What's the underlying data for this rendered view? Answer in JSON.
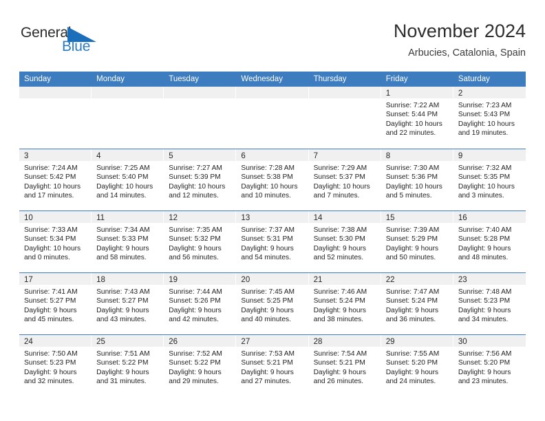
{
  "logo": {
    "word_one": "General",
    "word_two": "Blue",
    "triangle_icon": "blue-triangle-icon",
    "blue": "#2b7cc4",
    "dark": "#2b2b2b"
  },
  "header": {
    "title": "November 2024",
    "subtitle": "Arbucies, Catalonia, Spain"
  },
  "calendar": {
    "accent_color": "#3c7cbf",
    "day_band_color": "#f0f0f0",
    "weekdays": [
      "Sunday",
      "Monday",
      "Tuesday",
      "Wednesday",
      "Thursday",
      "Friday",
      "Saturday"
    ],
    "weeks": [
      [
        {
          "day": "",
          "lines": []
        },
        {
          "day": "",
          "lines": []
        },
        {
          "day": "",
          "lines": []
        },
        {
          "day": "",
          "lines": []
        },
        {
          "day": "",
          "lines": []
        },
        {
          "day": "1",
          "lines": [
            "Sunrise: 7:22 AM",
            "Sunset: 5:44 PM",
            "Daylight: 10 hours",
            "and 22 minutes."
          ]
        },
        {
          "day": "2",
          "lines": [
            "Sunrise: 7:23 AM",
            "Sunset: 5:43 PM",
            "Daylight: 10 hours",
            "and 19 minutes."
          ]
        }
      ],
      [
        {
          "day": "3",
          "lines": [
            "Sunrise: 7:24 AM",
            "Sunset: 5:42 PM",
            "Daylight: 10 hours",
            "and 17 minutes."
          ]
        },
        {
          "day": "4",
          "lines": [
            "Sunrise: 7:25 AM",
            "Sunset: 5:40 PM",
            "Daylight: 10 hours",
            "and 14 minutes."
          ]
        },
        {
          "day": "5",
          "lines": [
            "Sunrise: 7:27 AM",
            "Sunset: 5:39 PM",
            "Daylight: 10 hours",
            "and 12 minutes."
          ]
        },
        {
          "day": "6",
          "lines": [
            "Sunrise: 7:28 AM",
            "Sunset: 5:38 PM",
            "Daylight: 10 hours",
            "and 10 minutes."
          ]
        },
        {
          "day": "7",
          "lines": [
            "Sunrise: 7:29 AM",
            "Sunset: 5:37 PM",
            "Daylight: 10 hours",
            "and 7 minutes."
          ]
        },
        {
          "day": "8",
          "lines": [
            "Sunrise: 7:30 AM",
            "Sunset: 5:36 PM",
            "Daylight: 10 hours",
            "and 5 minutes."
          ]
        },
        {
          "day": "9",
          "lines": [
            "Sunrise: 7:32 AM",
            "Sunset: 5:35 PM",
            "Daylight: 10 hours",
            "and 3 minutes."
          ]
        }
      ],
      [
        {
          "day": "10",
          "lines": [
            "Sunrise: 7:33 AM",
            "Sunset: 5:34 PM",
            "Daylight: 10 hours",
            "and 0 minutes."
          ]
        },
        {
          "day": "11",
          "lines": [
            "Sunrise: 7:34 AM",
            "Sunset: 5:33 PM",
            "Daylight: 9 hours",
            "and 58 minutes."
          ]
        },
        {
          "day": "12",
          "lines": [
            "Sunrise: 7:35 AM",
            "Sunset: 5:32 PM",
            "Daylight: 9 hours",
            "and 56 minutes."
          ]
        },
        {
          "day": "13",
          "lines": [
            "Sunrise: 7:37 AM",
            "Sunset: 5:31 PM",
            "Daylight: 9 hours",
            "and 54 minutes."
          ]
        },
        {
          "day": "14",
          "lines": [
            "Sunrise: 7:38 AM",
            "Sunset: 5:30 PM",
            "Daylight: 9 hours",
            "and 52 minutes."
          ]
        },
        {
          "day": "15",
          "lines": [
            "Sunrise: 7:39 AM",
            "Sunset: 5:29 PM",
            "Daylight: 9 hours",
            "and 50 minutes."
          ]
        },
        {
          "day": "16",
          "lines": [
            "Sunrise: 7:40 AM",
            "Sunset: 5:28 PM",
            "Daylight: 9 hours",
            "and 48 minutes."
          ]
        }
      ],
      [
        {
          "day": "17",
          "lines": [
            "Sunrise: 7:41 AM",
            "Sunset: 5:27 PM",
            "Daylight: 9 hours",
            "and 45 minutes."
          ]
        },
        {
          "day": "18",
          "lines": [
            "Sunrise: 7:43 AM",
            "Sunset: 5:27 PM",
            "Daylight: 9 hours",
            "and 43 minutes."
          ]
        },
        {
          "day": "19",
          "lines": [
            "Sunrise: 7:44 AM",
            "Sunset: 5:26 PM",
            "Daylight: 9 hours",
            "and 42 minutes."
          ]
        },
        {
          "day": "20",
          "lines": [
            "Sunrise: 7:45 AM",
            "Sunset: 5:25 PM",
            "Daylight: 9 hours",
            "and 40 minutes."
          ]
        },
        {
          "day": "21",
          "lines": [
            "Sunrise: 7:46 AM",
            "Sunset: 5:24 PM",
            "Daylight: 9 hours",
            "and 38 minutes."
          ]
        },
        {
          "day": "22",
          "lines": [
            "Sunrise: 7:47 AM",
            "Sunset: 5:24 PM",
            "Daylight: 9 hours",
            "and 36 minutes."
          ]
        },
        {
          "day": "23",
          "lines": [
            "Sunrise: 7:48 AM",
            "Sunset: 5:23 PM",
            "Daylight: 9 hours",
            "and 34 minutes."
          ]
        }
      ],
      [
        {
          "day": "24",
          "lines": [
            "Sunrise: 7:50 AM",
            "Sunset: 5:23 PM",
            "Daylight: 9 hours",
            "and 32 minutes."
          ]
        },
        {
          "day": "25",
          "lines": [
            "Sunrise: 7:51 AM",
            "Sunset: 5:22 PM",
            "Daylight: 9 hours",
            "and 31 minutes."
          ]
        },
        {
          "day": "26",
          "lines": [
            "Sunrise: 7:52 AM",
            "Sunset: 5:22 PM",
            "Daylight: 9 hours",
            "and 29 minutes."
          ]
        },
        {
          "day": "27",
          "lines": [
            "Sunrise: 7:53 AM",
            "Sunset: 5:21 PM",
            "Daylight: 9 hours",
            "and 27 minutes."
          ]
        },
        {
          "day": "28",
          "lines": [
            "Sunrise: 7:54 AM",
            "Sunset: 5:21 PM",
            "Daylight: 9 hours",
            "and 26 minutes."
          ]
        },
        {
          "day": "29",
          "lines": [
            "Sunrise: 7:55 AM",
            "Sunset: 5:20 PM",
            "Daylight: 9 hours",
            "and 24 minutes."
          ]
        },
        {
          "day": "30",
          "lines": [
            "Sunrise: 7:56 AM",
            "Sunset: 5:20 PM",
            "Daylight: 9 hours",
            "and 23 minutes."
          ]
        }
      ]
    ]
  }
}
